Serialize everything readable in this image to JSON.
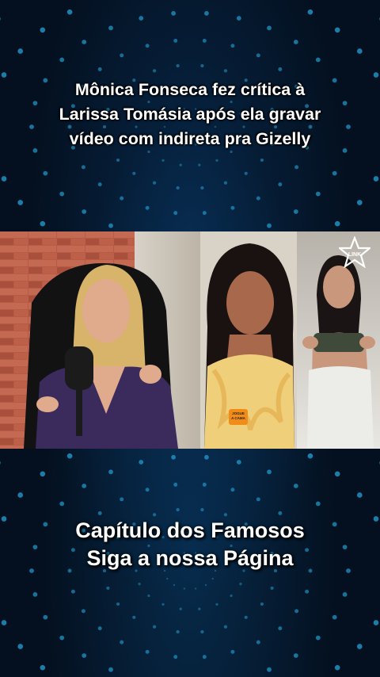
{
  "headline": {
    "line1": "Mônica Fonseca fez crítica à",
    "line2": "Larissa Tomásia após ela gravar",
    "line3": "vídeo com indireta pra Gizelly"
  },
  "footer": {
    "line1": "Capítulo dos Famosos",
    "line2": "Siga a nossa Página"
  },
  "watermark": {
    "text": "LINK"
  },
  "badge": {
    "line1": "JOGUE",
    "line2": "A CAMA"
  },
  "colors": {
    "background": "#04101f",
    "dots": "#29c4ff",
    "brick": "#b85a45",
    "badge": "#f28c17"
  }
}
